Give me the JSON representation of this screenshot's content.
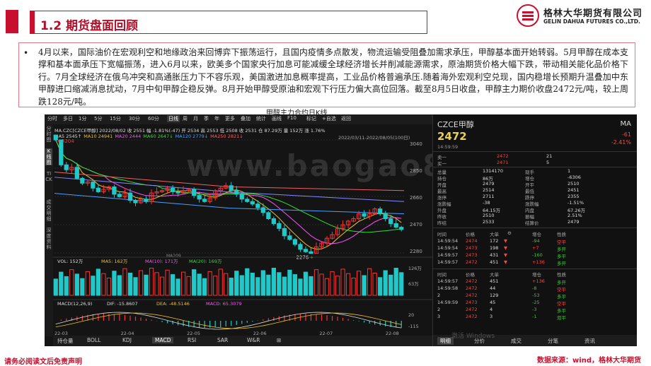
{
  "slide": {
    "title": "1.2  期货盘面回顾",
    "logo_cn": "格林大华期货有限公司",
    "logo_en": "GELIN DAHUA FUTURES CO.,LTD.",
    "bullet": "•",
    "paragraph": "4月以来，国际油价在宏观利空和地缘政治来回博弈下振荡运行，且国内疫情多点散发，物流运输受阻叠加需求承压，甲醇基本面开始转弱。5月甲醇在成本支撑和基本面承压下宽幅振荡，进入6月以来，欧美多个国家央行加息可能减缓全球经济增长并削减能源需求，原油期货价格大幅下跌，带动相关能化品价格下行。7月全球经济在俄乌冲突和高通胀压力下不容乐观，美国激进加息概率提高，工业品价格普遍承压.随着海外宏观利空兑现，国内稳增长预期升温叠加中东甲醇进口缩减消息扰动，7月中旬甲醇企稳反弹。8月开始甲醇受原油和宏观下行压力偏大高位回落。截至8月5日收盘，甲醇主力期价收盘2472元/吨，较上周跌128元/吨。",
    "chart_caption": "甲醇主力合约日K线",
    "footer_left": "请务必阅读文后免责声明",
    "footer_right": "数据来源：wind，格林大华期货",
    "watermark": "www.baogao8.com",
    "win_watermark": "激活 Windows"
  },
  "terminal": {
    "toolbar": [
      "分时",
      "多日",
      "1分",
      "5分",
      "15分",
      "30分",
      "60分",
      "日线",
      "周",
      "月",
      "季",
      "年",
      "更多",
      "叠加",
      "统计",
      "画线",
      "F10",
      "标记",
      "+自选",
      "返回"
    ],
    "toolbar_active": "日线",
    "side_tabs": [
      "分时图",
      "K线图",
      "TICK",
      "成交明细",
      "深度资料"
    ],
    "ma_header": "MA.CZC[CZCE甲醇]  2022/08/02  收 2551  幅 -1.81%(-47)  开 2534  高 2553  低 2508  收 2531  仓 87.29万  量 152万  涨 1.76%",
    "ma_values": {
      "label": "MA5",
      "ma5": "2545",
      "ma10": "24941",
      "ma20": "2444",
      "ma60": "2647",
      "ma120": "2779",
      "ma250": "2821"
    },
    "ma_items": [
      "MA5 2545↑",
      "MA10 24941",
      "MA20 2444",
      "MA60 2647↓",
      "MA120 2779↓",
      "MA250 2821↓"
    ],
    "range_label": "2022/03/11-2022/08/05(100日)",
    "vol_header": [
      "VOL: 152万",
      "MA5: 162万",
      "MA(10): 171万",
      "MA(20): 169万"
    ],
    "macd_header": [
      "MACD(12,26,9)",
      "DIF: -15.8607",
      "DEA: -48.5146",
      "MACD: 65.3079"
    ],
    "price_axis": [
      "3040",
      "2850",
      "2660",
      "2470",
      "2280"
    ],
    "vol_axis": [
      "126万",
      "63万"
    ],
    "macd_axis": [
      "20",
      "-115"
    ],
    "date_axis": [
      "22-03",
      "22-04",
      "22-05",
      "22-06",
      "22-07",
      "22-08"
    ],
    "high_label": "3204",
    "low_label": "2276",
    "ma_mark": "MA209",
    "bottom_tabs": [
      "持仓量",
      "BOLL",
      "KDJ",
      "MACD",
      "RSI",
      "SAR",
      "W&R",
      "⊞"
    ],
    "bottom_active": "MACD"
  },
  "quote": {
    "name": "CZCE甲醇",
    "price": "2472",
    "ma_label": "MA",
    "change": "-61",
    "pct": "-2.41%",
    "time": "14:59:59",
    "bid_ask": [
      {
        "label": "卖一",
        "price": "2472",
        "vol": "21"
      },
      {
        "label": "买一",
        "price": "2471",
        "vol": "5"
      }
    ],
    "stats": [
      {
        "l1": "总量",
        "v1": "1314170",
        "l2": "现手",
        "v2": "1"
      },
      {
        "l1": "持仓",
        "v1": "86万",
        "l2": "增仓",
        "v2": "-6306"
      },
      {
        "l1": "开盘",
        "v1": "2479",
        "l2": "开平",
        "v2": "2510"
      },
      {
        "l1": "最高",
        "v1": "2514",
        "l2": "最低",
        "v2": "2451"
      },
      {
        "l1": "涨停",
        "v1": "2711",
        "l2": "跌停",
        "v2": "2355"
      },
      {
        "l1": "涨跌幅",
        "v1": "-38",
        "l2": "涨跌幅",
        "v2": "-1.51%"
      },
      {
        "l1": "外盘",
        "v1": "64.15万",
        "l2": "内盘",
        "v2": "67.26万"
      },
      {
        "l1": "昨收",
        "v1": "2510",
        "l2": "振幅",
        "v2": "2.51%"
      },
      {
        "l1": "昨结",
        "v1": "2533",
        "l2": "结算价",
        "v2": "2479"
      }
    ],
    "tick_head": [
      "时间",
      "价格",
      "大单",
      "⚙",
      "增仓",
      "性质"
    ],
    "ticks1": [
      {
        "t": "14:59:54",
        "p": "2474",
        "v": "172",
        "d": "▼",
        "oi": "-94",
        "nat": "空平"
      },
      {
        "t": "14:59:54",
        "p": "2473",
        "v": "198",
        "d": "▼",
        "oi": "+7",
        "nat": "多开"
      },
      {
        "t": "14:59:57",
        "p": "2473",
        "v": "431",
        "d": "▼",
        "oi": "-160",
        "nat": "多平"
      },
      {
        "t": "14:59:57",
        "p": "2472",
        "v": "451",
        "d": "▼",
        "oi": "+136",
        "nat": "多开"
      }
    ],
    "ticks2": [
      {
        "t": "14:59:57",
        "p": "2472",
        "v": "451",
        "oi": "+136",
        "nat": "多开"
      },
      {
        "t": "14:59:58",
        "p": "2472",
        "v": "44",
        "oi": "-8",
        "nat": "空平"
      },
      {
        "t": "2",
        "p": "2472",
        "v": "129",
        "oi": "-53",
        "nat": "多平"
      },
      {
        "t": "14:59:59",
        "p": "2473",
        "v": "45",
        "oi": "-25",
        "nat": "空平"
      },
      {
        "t": "2",
        "p": "2472",
        "v": "4",
        "oi": "-3",
        "nat": "多平"
      },
      {
        "t": "3",
        "p": "2472",
        "v": "3",
        "oi": "-1",
        "nat": "双平"
      }
    ],
    "footer_tabs": [
      "明细",
      "分价",
      "成交",
      "分笔",
      "资讯"
    ],
    "footer_active": "明细"
  },
  "chart_data": {
    "type": "candlestick",
    "title": "甲醇主力合约日K线",
    "x": [
      "22-03",
      "22-04",
      "22-05",
      "22-06",
      "22-07",
      "22-08"
    ],
    "ylim": [
      2280,
      3204
    ],
    "closes_approx": [
      3204,
      3000,
      2960,
      2980,
      2890,
      2850,
      2860,
      2810,
      2780,
      2800,
      2820,
      2760,
      2740,
      2770,
      2710,
      2690,
      2720,
      2700,
      2770,
      2780,
      2790,
      2810,
      2780,
      2770,
      2790,
      2800,
      2750,
      2720,
      2700,
      2730,
      2790,
      2810,
      2830,
      2790,
      2760,
      2720,
      2700,
      2680,
      2650,
      2610,
      2560,
      2520,
      2480,
      2420,
      2390,
      2350,
      2310,
      2290,
      2276,
      2330,
      2360,
      2400,
      2430,
      2480,
      2510,
      2540,
      2560,
      2600,
      2580,
      2600,
      2640,
      2600,
      2560,
      2520,
      2490,
      2472
    ]
  }
}
